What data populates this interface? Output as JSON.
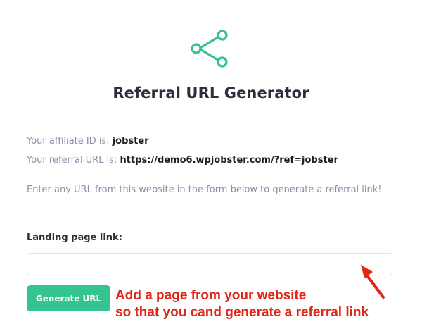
{
  "header": {
    "icon": "share-icon",
    "title": "Referral URL Generator"
  },
  "info": {
    "affiliate_label": "Your affiliate ID is:",
    "affiliate_id": "jobster",
    "referral_label": "Your referral URL is:",
    "referral_url": "https://demo6.wpjobster.com/?ref=jobster"
  },
  "instructions": "Enter any URL from this website in the form below to generate a referral link!",
  "form": {
    "landing_label": "Landing page link:",
    "landing_value": "",
    "generate_label": "Generate URL"
  },
  "annotation": {
    "line1": "Add a page from your website",
    "line2": "so that you cand generate a referral link",
    "arrow_icon": "red-arrow-icon"
  },
  "colors": {
    "accent": "#34c490",
    "title": "#2c2e3a",
    "muted_text": "#8a8fa8",
    "annotation": "#e02618"
  }
}
